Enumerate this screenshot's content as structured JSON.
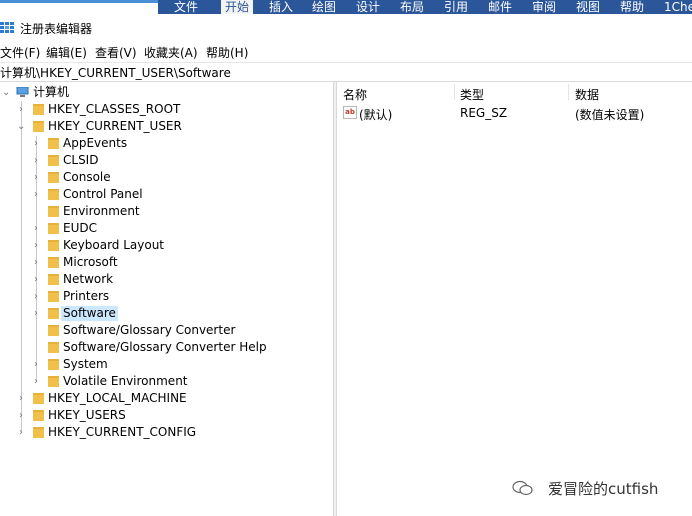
{
  "ribbon": {
    "tabs": [
      "文件",
      "开始",
      "插入",
      "绘图",
      "设计",
      "布局",
      "引用",
      "邮件",
      "审阅",
      "视图",
      "帮助",
      "1Che"
    ],
    "active_tab": "开始"
  },
  "window": {
    "title": "注册表编辑器"
  },
  "menu": [
    "文件(F)",
    "编辑(E)",
    "查看(V)",
    "收藏夹(A)",
    "帮助(H)"
  ],
  "address": "计算机\\HKEY_CURRENT_USER\\Software",
  "tree": {
    "root": "计算机",
    "nodes": [
      {
        "label": "HKEY_CLASSES_ROOT",
        "level": 1,
        "expander": "collapsed"
      },
      {
        "label": "HKEY_CURRENT_USER",
        "level": 1,
        "expander": "expanded"
      },
      {
        "label": "AppEvents",
        "level": 2,
        "expander": "collapsed"
      },
      {
        "label": "CLSID",
        "level": 2,
        "expander": "collapsed"
      },
      {
        "label": "Console",
        "level": 2,
        "expander": "collapsed"
      },
      {
        "label": "Control Panel",
        "level": 2,
        "expander": "collapsed"
      },
      {
        "label": "Environment",
        "level": 2,
        "expander": "none"
      },
      {
        "label": "EUDC",
        "level": 2,
        "expander": "collapsed"
      },
      {
        "label": "Keyboard Layout",
        "level": 2,
        "expander": "collapsed"
      },
      {
        "label": "Microsoft",
        "level": 2,
        "expander": "collapsed"
      },
      {
        "label": "Network",
        "level": 2,
        "expander": "collapsed"
      },
      {
        "label": "Printers",
        "level": 2,
        "expander": "collapsed"
      },
      {
        "label": "Software",
        "level": 2,
        "expander": "collapsed",
        "selected": true
      },
      {
        "label": "Software/Glossary Converter",
        "level": 2,
        "expander": "none"
      },
      {
        "label": "Software/Glossary Converter Help",
        "level": 2,
        "expander": "none"
      },
      {
        "label": "System",
        "level": 2,
        "expander": "collapsed"
      },
      {
        "label": "Volatile Environment",
        "level": 2,
        "expander": "collapsed"
      },
      {
        "label": "HKEY_LOCAL_MACHINE",
        "level": 1,
        "expander": "collapsed"
      },
      {
        "label": "HKEY_USERS",
        "level": 1,
        "expander": "collapsed"
      },
      {
        "label": "HKEY_CURRENT_CONFIG",
        "level": 1,
        "expander": "collapsed"
      }
    ]
  },
  "list": {
    "columns": [
      "名称",
      "类型",
      "数据"
    ],
    "rows": [
      {
        "icon": "ab",
        "name": "(默认)",
        "type": "REG_SZ",
        "data": "(数值未设置)"
      }
    ]
  },
  "watermark": {
    "text": "爱冒险的cutfish"
  },
  "colors": {
    "ribbon": "#2b579a",
    "folder": "#f0c04a",
    "selection": "#cce8ff"
  }
}
